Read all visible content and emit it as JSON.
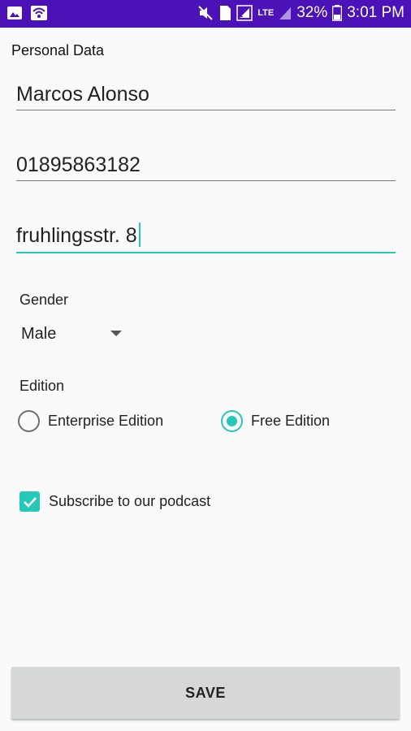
{
  "status_bar": {
    "battery": "32%",
    "time": "3:01 PM",
    "network": "LTE",
    "sim_badge": "1",
    "icons": [
      "image-icon",
      "wifi-icon",
      "mute-icon",
      "sim-icon",
      "signal-icon",
      "battery-icon"
    ]
  },
  "form": {
    "section_title": "Personal Data",
    "name_value": "Marcos Alonso",
    "phone_value": "01895863182",
    "address_value": "fruhlingsstr. 8",
    "gender_label": "Gender",
    "gender_selected": "Male",
    "edition_label": "Edition",
    "edition_options": [
      {
        "label": "Enterprise Edition",
        "checked": false
      },
      {
        "label": "Free Edition",
        "checked": true
      }
    ],
    "subscribe_label": "Subscribe to our podcast",
    "subscribe_checked": true,
    "save_label": "SAVE"
  },
  "colors": {
    "status_bar": "#4a12b7",
    "accent": "#24c9b8",
    "button": "#d6d7d7"
  }
}
